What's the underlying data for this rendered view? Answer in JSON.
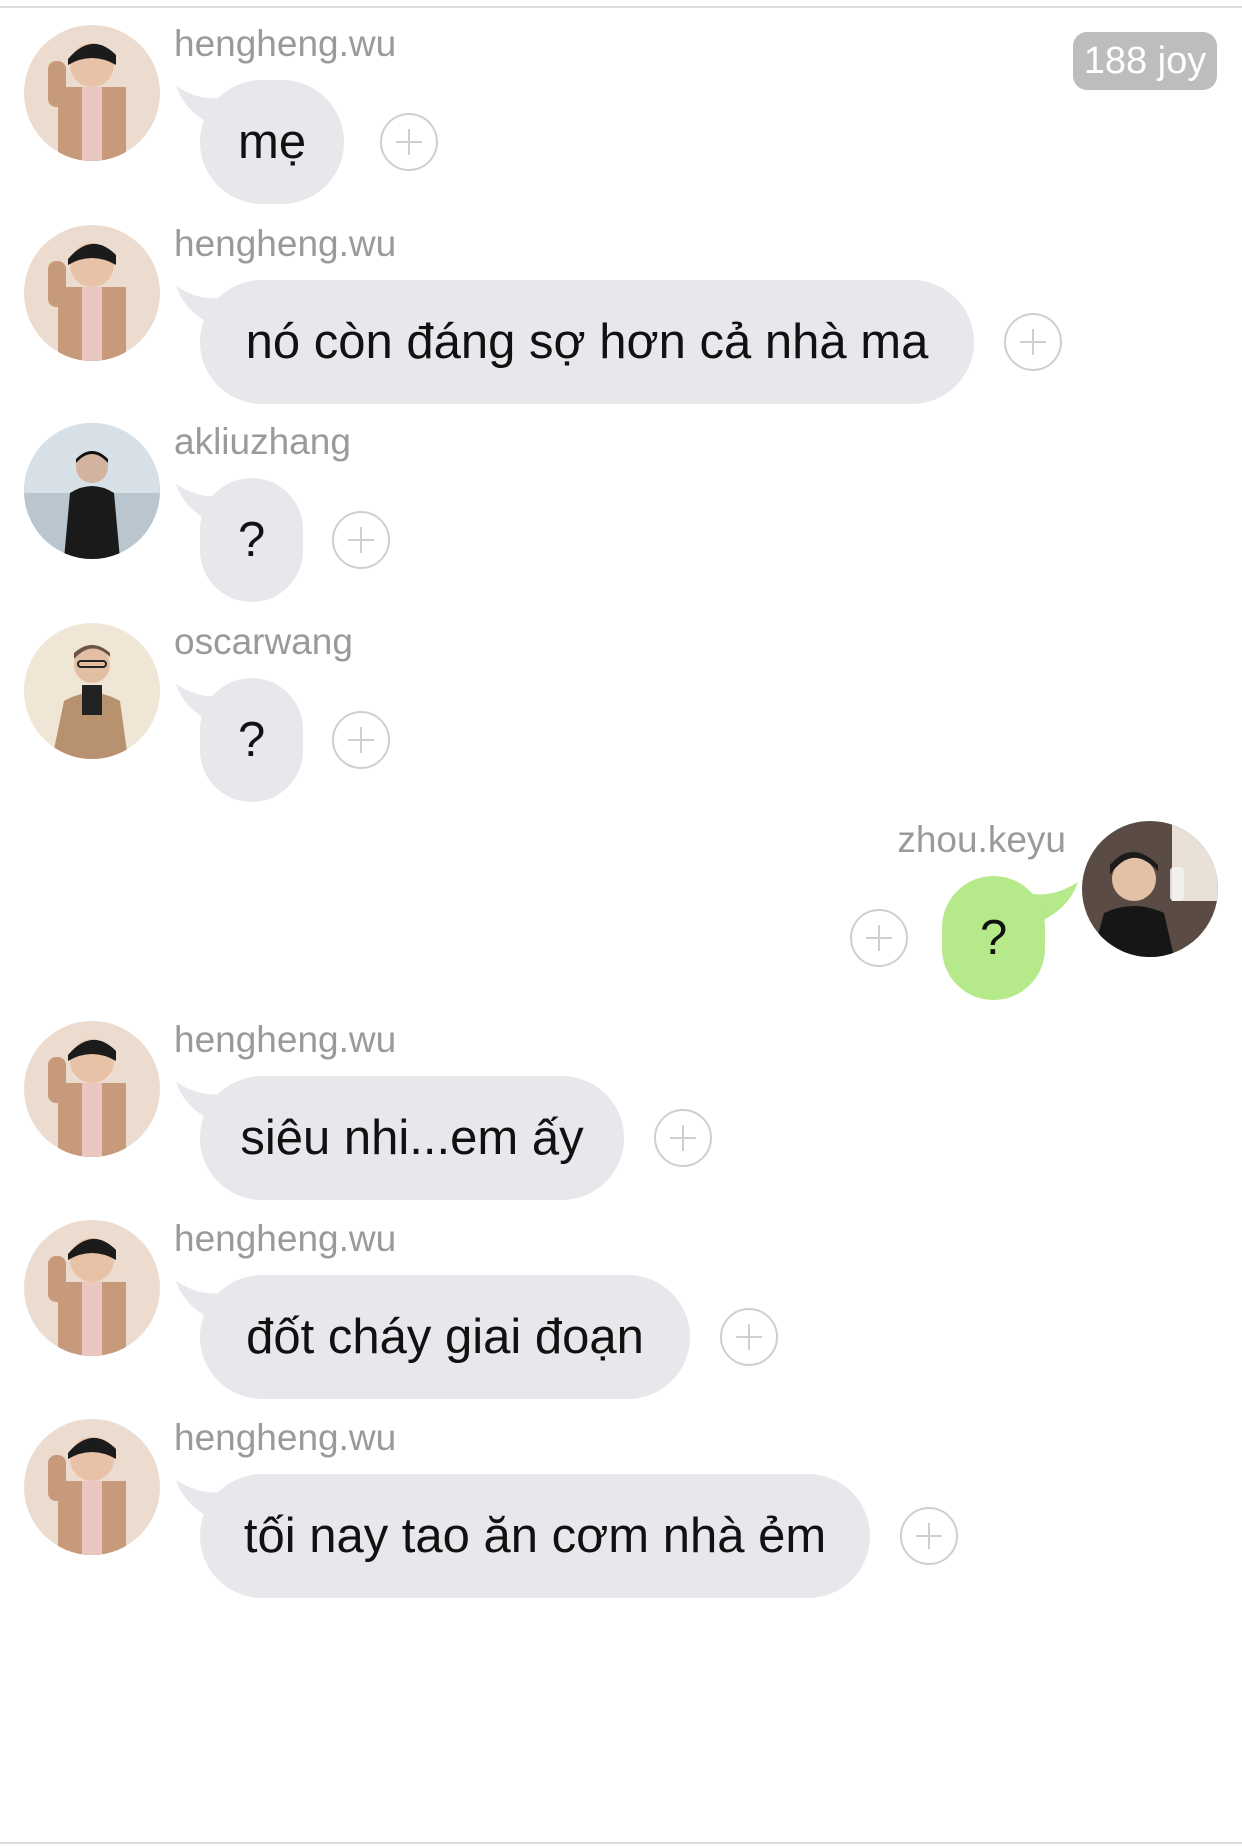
{
  "badge": {
    "label": "188 joy"
  },
  "messages": [
    {
      "user": "hengheng.wu",
      "text": "mẹ",
      "side": "left",
      "avatar": "hengheng"
    },
    {
      "user": "hengheng.wu",
      "text": "nó còn đáng sợ hơn cả nhà ma",
      "side": "left",
      "avatar": "hengheng"
    },
    {
      "user": "akliuzhang",
      "text": "?",
      "side": "left",
      "avatar": "akliuzhang"
    },
    {
      "user": "oscarwang",
      "text": "?",
      "side": "left",
      "avatar": "oscarwang"
    },
    {
      "user": "zhou.keyu",
      "text": "?",
      "side": "right",
      "avatar": "zhoukeyu"
    },
    {
      "user": "hengheng.wu",
      "text": "siêu nhi...em ấy",
      "side": "left",
      "avatar": "hengheng"
    },
    {
      "user": "hengheng.wu",
      "text": "đốt cháy giai đoạn",
      "side": "left",
      "avatar": "hengheng"
    },
    {
      "user": "hengheng.wu",
      "text": "tối nay tao ăn cơm nhà ẻm",
      "side": "left",
      "avatar": "hengheng"
    }
  ],
  "colors": {
    "incoming_bubble": "#e6e8eb",
    "outgoing_bubble": "#b5e98a",
    "username": "#9a9a9a",
    "plus_icon": "#cfcfcf"
  }
}
